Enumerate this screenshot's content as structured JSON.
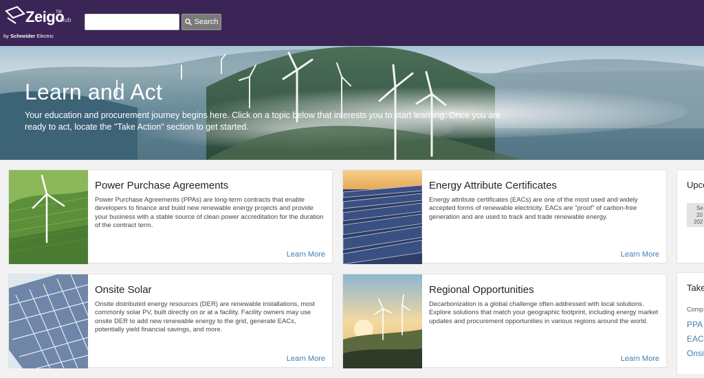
{
  "header": {
    "logo": {
      "brand": "Zeigo",
      "tm": "TM",
      "product": "Hub",
      "by": "by",
      "parent_bold": "Schneider",
      "parent_rest": " Electric"
    },
    "search": {
      "value": "",
      "placeholder": "",
      "button_label": "Search",
      "button_icon": "search-icon"
    }
  },
  "hero": {
    "title": "Learn and Act",
    "description": "Your education and procurement journey begins here. Click on a topic below that interests you to start learning. Once you are ready to act, locate the \"Take Action\" section to get started."
  },
  "cards": [
    {
      "title": "Power Purchase Agreements",
      "description": "Power Purchase Agreements (PPAs) are long-term contracts that enable developers to finance and build new renewable energy projects and provide your business with a stable source of clean power accreditation for the duration of the contract term.",
      "link": "Learn More"
    },
    {
      "title": "Energy Attribute Certificates",
      "description": "Energy attribute certificates (EACs) are one of the most used and widely accepted forms of renewable electricity. EACs are \"proof\" of carbon-free generation and are used to track and trade renewable energy.",
      "link": "Learn More"
    },
    {
      "title": "Onsite Solar",
      "description": "Onsite distributed energy resources (DER) are renewable installations, most commonly solar PV, built directly on or at a facility. Facility owners may use onsite DER to add new renewable energy to the grid, generate EACs, potentially yield financial savings, and more.",
      "link": "Learn More"
    },
    {
      "title": "Regional Opportunities",
      "description": "Decarbonization is a global challenge often addressed with local solutions. Explore solutions that match your geographic footprint, including energy market updates and procurement opportunities in various regions around the world.",
      "link": "Learn More"
    }
  ],
  "sidebar": {
    "upcoming": {
      "title": "Upco",
      "date_lines": [
        "Se",
        "20",
        "202"
      ]
    },
    "take_action": {
      "title": "Take",
      "subtitle": "Comp",
      "links": [
        "PPA",
        "EAC",
        "Onsi"
      ]
    }
  },
  "colors": {
    "header_bg": "#3b2456",
    "link": "#3f7fb5",
    "page_bg": "#f2f2f2"
  }
}
